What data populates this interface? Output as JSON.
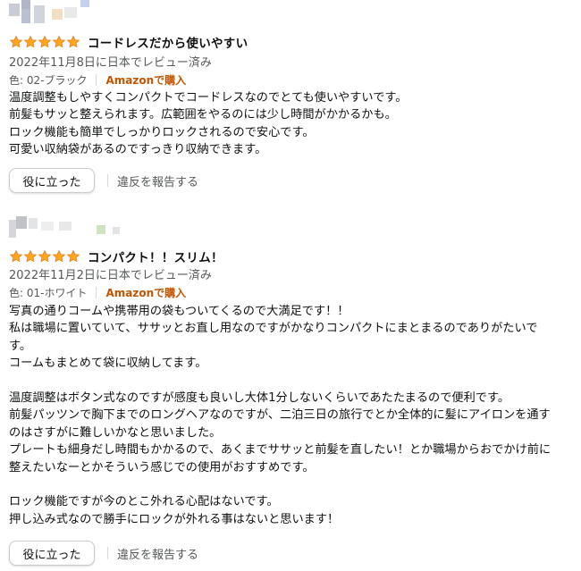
{
  "reviews": [
    {
      "rating": 5,
      "title": "コードレスだから使いやすい",
      "date": "2022年11月8日に日本でレビュー済み",
      "variant": "色: 02-ブラック",
      "verified": "Amazonで購入",
      "body": [
        "温度調整もしやすくコンパクトでコードレスなのでとても使いやすいです。",
        "前髪もサッと整えられます。広範囲をやるのには少し時間がかかるかも。",
        "ロック機能も簡単でしっかりロックされるので安心です。",
        "可愛い収納袋があるのですっきり収納できます。"
      ],
      "helpful_label": "役に立った",
      "report_label": "違反を報告する"
    },
    {
      "rating": 5,
      "title": "コンパクト！！スリム！",
      "date": "2022年11月2日に日本でレビュー済み",
      "variant": "色: 01-ホワイト",
      "verified": "Amazonで購入",
      "body": [
        "写真の通りコームや携帯用の袋もついてくるので大満足です！！",
        "私は職場に置いていて、ササッとお直し用なのですがかなりコンパクトにまとまるのでありがたいで",
        "す。",
        "コームもまとめて袋に収納してます。",
        "",
        "温度調整はボタン式なのですが感度も良いし大体1分しないくらいであたたまるので便利です。",
        "前髪パッツンで胸下までのロングヘアなのですが、二泊三日の旅行でとか全体的に髪にアイロンを通す",
        "のはさすがに難しいかなと思いました。",
        "プレートも細身だし時間もかかるので、あくまでササッと前髪を直したい！とか職場からおでかけ前に",
        "整えたいなーとかそういう感じでの使用がおすすめです。",
        "",
        "ロック機能ですが今のとこ外れる心配はないです。",
        "押し込み式なので勝手にロックが外れる事はないと思います！"
      ],
      "helpful_label": "役に立った",
      "report_label": "違反を報告する"
    }
  ],
  "colors": {
    "star": "#ffa41c",
    "star_stroke": "#de7921",
    "verified": "#c45500",
    "muted": "#565959",
    "text": "#0f1111"
  }
}
